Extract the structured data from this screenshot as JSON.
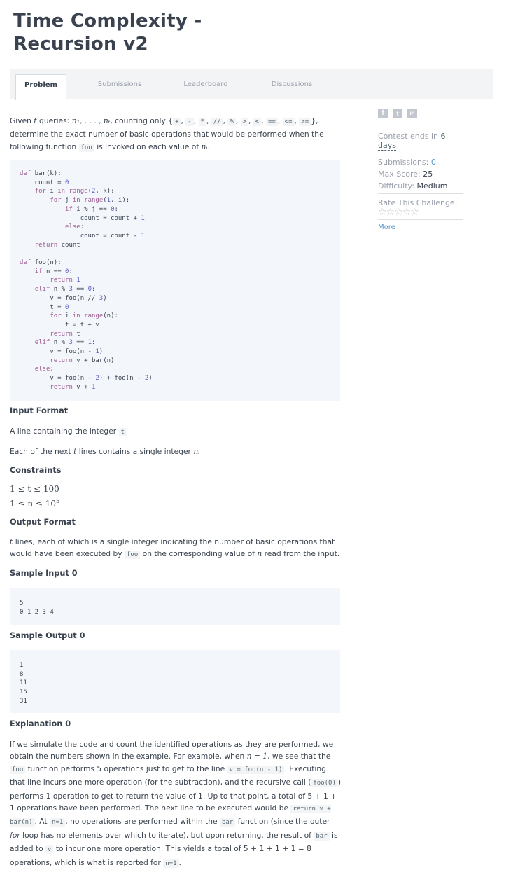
{
  "title": "Time Complexity - Recursion v2",
  "tabs": [
    {
      "label": "Problem",
      "active": true
    },
    {
      "label": "Submissions",
      "active": false
    },
    {
      "label": "Leaderboard",
      "active": false
    },
    {
      "label": "Discussions",
      "active": false
    }
  ],
  "sidebar": {
    "social_icons": [
      "facebook-icon",
      "twitter-icon",
      "linkedin-icon"
    ],
    "contest_label": "Contest ends in",
    "contest_value": "6 days",
    "submissions_label": "Submissions:",
    "submissions_value": "0",
    "max_score_label": "Max Score:",
    "max_score_value": "25",
    "difficulty_label": "Difficulty:",
    "difficulty_value": "Medium",
    "rate_label": "Rate This Challenge:",
    "rating_stars": 5,
    "rating_value": 0,
    "more_label": "More"
  },
  "intro": {
    "p1": "Given",
    "t": "t",
    "p2": "queries:",
    "n_seq": "n₁, . . . , nₜ",
    "p3": ", counting only {",
    "ops": [
      "+",
      "-",
      "*",
      "//",
      "%",
      ">",
      "<",
      "==",
      "<=",
      ">="
    ],
    "p4": "},",
    "p5": "determine the exact number of basic operations that would be performed when the following function",
    "foo": "foo",
    "p6": "is invoked on each value of",
    "n_i": "nᵢ",
    "p7": "."
  },
  "code": {
    "bar": [
      "def bar(k):",
      "    count = 0",
      "    for i in range(2, k):",
      "        for j in range(1, i):",
      "            if i % j == 0:",
      "                count = count + 1",
      "            else:",
      "                count = count - 1",
      "    return count"
    ],
    "foo": [
      "def foo(n):",
      "    if n == 0:",
      "        return 1",
      "    elif n % 3 == 0:",
      "        v = foo(n // 3)",
      "        t = 0",
      "        for i in range(n):",
      "            t = t + v",
      "        return t",
      "    elif n % 3 == 1:",
      "        v = foo(n - 1)",
      "        return v + bar(n)",
      "    else:",
      "        v = foo(n - 2) + foo(n - 2)",
      "        return v + 1"
    ]
  },
  "input_format": {
    "heading": "Input Format",
    "line1_a": "A line containing the integer",
    "line1_code": "t",
    "line2_a": "Each of the next",
    "line2_t": "t",
    "line2_b": "lines contains a single integer",
    "line2_n": "nᵢ"
  },
  "constraints": {
    "heading": "Constraints",
    "c1": "1 ≤ t ≤ 100",
    "c2_base": "1 ≤ n ≤ 10",
    "c2_exp": "5"
  },
  "output_format": {
    "heading": "Output Format",
    "t": "t",
    "a": "lines, each of which is a single integer indicating the number of basic operations that would have been executed by",
    "foo": "foo",
    "b": "on the corresponding value of",
    "n": "n",
    "c": "read from the input."
  },
  "sample_input": {
    "heading": "Sample Input 0",
    "lines": [
      "5",
      "0 1 2 3 4"
    ]
  },
  "sample_output": {
    "heading": "Sample Output 0",
    "lines": [
      "1",
      "8",
      "11",
      "15",
      "31"
    ]
  },
  "explanation": {
    "heading": "Explanation 0",
    "s1": "If we simulate the code and count the identified operations as they are performed, we obtain the numbers shown in the example. For example, when",
    "n_eq_1": "n = 1",
    "s2": ", we see that the",
    "foo": "foo",
    "s3": "function performs 5 operations just to get to the line",
    "code1": "v = foo(n - 1)",
    "s4": ". Executing that line incurs one more operation (for the subtraction), and the recursive call (",
    "code2": "foo(0)",
    "s5": ") performs 1 operation to get to return the value of 1. Up to that point, a total of 5 + 1 + 1 operations have been performed. The next line to be executed would be",
    "code3": "return v + bar(n)",
    "s6": ". At",
    "code4": "n=1",
    "s7": ", no operations are performed within the",
    "code5": "bar",
    "s8": "function (since the outer",
    "em": "for",
    "s9": "loop has no elements over which to iterate), but upon returning, the result of",
    "code6": "bar",
    "s10": "is added to",
    "code7": "v",
    "s11": "to incur one more operation. This yields a total of 5 + 1 + 1 + 1 = 8 operations, which is what is reported for",
    "code8": "n=1",
    "s12": "."
  },
  "colors": {
    "text": "#39424e",
    "muted": "#9aa0ab",
    "link": "#5a96c8",
    "code_bg": "#f3f6fb",
    "keyword": "#a05e94",
    "number": "#5b5fc7"
  }
}
